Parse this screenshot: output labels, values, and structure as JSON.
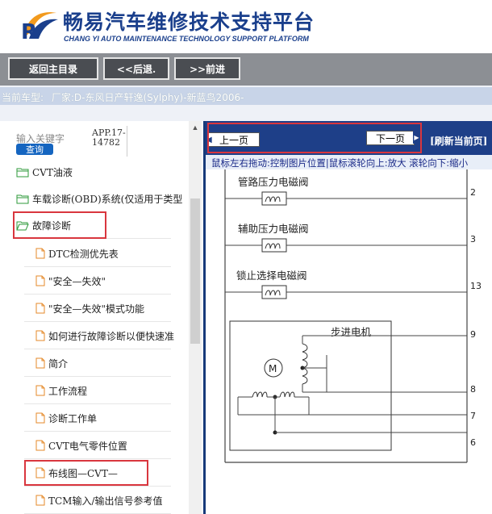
{
  "header": {
    "title": "畅易汽车维修技术支持平台",
    "subtitle": "CHANG YI AUTO MAINTENANCE TECHNOLOGY SUPPORT PLATFORM"
  },
  "nav": {
    "home_label": "返回主目录",
    "back_label": "<<后退.",
    "forward_label": ">>前进"
  },
  "vehicle": {
    "label": "当前车型:",
    "value": "厂家:D-东风日产轩逸(Sylphy)-新蓝鸟2006-"
  },
  "search": {
    "label": "输入关键字",
    "button": "查询",
    "app_version": "APP.17-14782"
  },
  "tree": {
    "items": [
      {
        "label": "CVT油液",
        "type": "folder"
      },
      {
        "label": "车载诊断(OBD)系统(仅适用于类型",
        "type": "folder"
      },
      {
        "label": "故障诊断",
        "type": "folder-open"
      },
      {
        "label": "DTC检测优先表",
        "type": "doc"
      },
      {
        "label": "\"安全—失效\"",
        "type": "doc"
      },
      {
        "label": "\"安全—失效\"模式功能",
        "type": "doc"
      },
      {
        "label": "如何进行故障诊断以便快速准",
        "type": "doc"
      },
      {
        "label": "简介",
        "type": "doc"
      },
      {
        "label": "工作流程",
        "type": "doc"
      },
      {
        "label": "诊断工作单",
        "type": "doc"
      },
      {
        "label": "CVT电气零件位置",
        "type": "doc"
      },
      {
        "label": "布线图—CVT—",
        "type": "doc"
      },
      {
        "label": "TCM输入/输出信号参考值",
        "type": "doc"
      }
    ]
  },
  "doc": {
    "prev_label": "上一页",
    "next_label": "下一页",
    "refresh_label": "[刷新当前页]",
    "hint": "鼠标左右拖动:控制图片位置|鼠标滚轮向上:放大  滚轮向下:缩小"
  },
  "diagram": {
    "components": [
      {
        "label": "管路压力电磁阀",
        "pin": "2"
      },
      {
        "label": "辅助压力电磁阀",
        "pin": "3"
      },
      {
        "label": "锁止选择电磁阀",
        "pin": "13"
      }
    ],
    "motor_label": "步进电机",
    "motor_symbol": "M",
    "motor_pins": [
      "9",
      "8",
      "7",
      "6"
    ]
  },
  "colors": {
    "brand": "#1a3f8c",
    "toolbar": "#1e3f88",
    "highlight": "#d9363e",
    "nav_bg": "#8c8f94"
  }
}
